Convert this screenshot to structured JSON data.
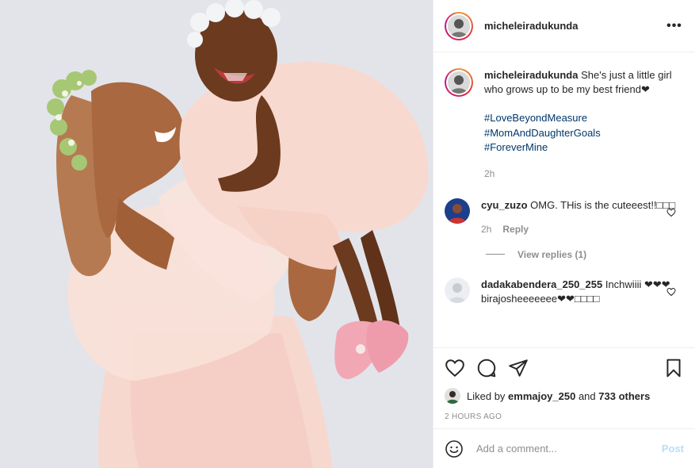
{
  "header": {
    "username": "micheleiradukunda",
    "more_label": "•••"
  },
  "caption": {
    "username": "micheleiradukunda",
    "text": "She's just a little girl who grows up to be my best friend❤",
    "hashtags": [
      "#LoveBeyondMeasure",
      "#MomAndDaughterGoals",
      "#ForeverMine"
    ],
    "time": "2h"
  },
  "comments": [
    {
      "username": "cyu_zuzo",
      "text": "OMG. THis is the cuteeest!!□□□",
      "time": "2h",
      "reply_label": "Reply"
    },
    {
      "username": "dadakabendera_250_255",
      "text": "Inchwiiii ❤❤❤birajosheeeeeee❤❤□□□□"
    }
  ],
  "view_replies_label": "View replies (1)",
  "likes": {
    "prefix": "Liked by",
    "user": "emmajoy_250",
    "and": "and",
    "others": "733 others"
  },
  "timestamp": "2 HOURS AGO",
  "add_comment": {
    "placeholder": "Add a comment...",
    "post_label": "Post"
  },
  "icons": {
    "like": "heart-icon",
    "comment": "comment-icon",
    "share": "send-icon",
    "save": "bookmark-icon",
    "emoji": "emoji-icon",
    "more": "more-icon"
  },
  "colors": {
    "link": "#00376b",
    "muted": "#8e8e8e",
    "post_disabled": "#b2dffc"
  }
}
